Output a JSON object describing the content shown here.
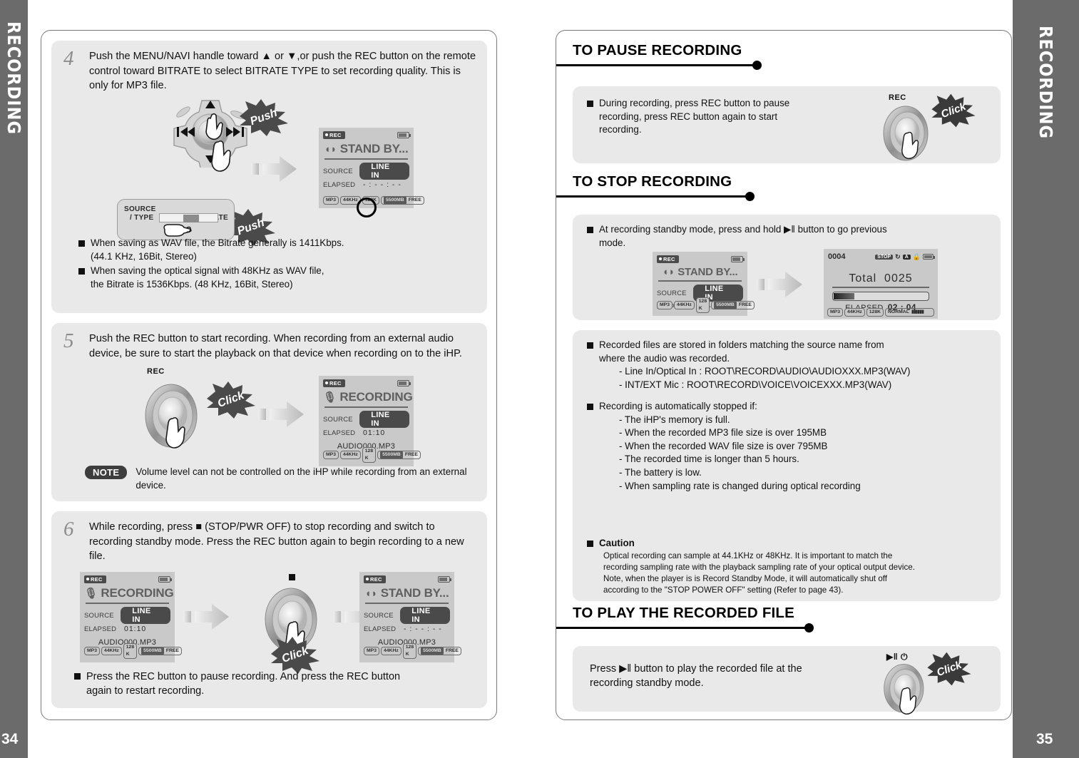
{
  "side_tabs": {
    "left_label": "RECORDING",
    "right_label": "RECORDING"
  },
  "page_numbers": {
    "left": "34",
    "right": "35"
  },
  "left_page": {
    "step4": {
      "number": "4",
      "text": "Push the MENU/NAVI handle toward ▲ or ▼,or push the REC button on the remote control toward BITRATE to select BITRATE TYPE to set recording quality. This is only for MP3 file.",
      "push_label_1": "Push",
      "push_label_2": "Push",
      "remote": {
        "left_label_line1": "SOURCE",
        "left_label_line2": "/ TYPE",
        "right_label": "BITRATE"
      },
      "lcd": {
        "rec": "REC",
        "title": "STAND BY...",
        "source_label": "SOURCE",
        "source_value": "LINE IN",
        "elapsed_label": "ELAPSED",
        "elapsed_value": "- : - - : - -",
        "tags": [
          "MP3",
          "44KHz",
          "128K"
        ],
        "used": "5500MB",
        "free": "FREE"
      },
      "bullets": [
        "When saving as WAV file, the Bitrate generally is 1411Kbps. (44.1 KHz, 16Bit, Stereo)",
        "When saving the optical signal with 48KHz as WAV file, the Bitrate is 1536Kbps. (48 KHz, 16Bit, Stereo)"
      ],
      "bullet_lines": [
        [
          "When saving as WAV file, the Bitrate generally is 1411Kbps.",
          "(44.1 KHz, 16Bit, Stereo)"
        ],
        [
          "When saving the optical signal with 48KHz as WAV file,",
          "the Bitrate is 1536Kbps. (48 KHz, 16Bit, Stereo)"
        ]
      ]
    },
    "step5": {
      "number": "5",
      "text": "Push the REC button to start recording. When recording from an external audio device, be sure to start the playback on that device when recording on to the iHP.",
      "rec_label": "REC",
      "click_label": "Click",
      "lcd": {
        "rec": "REC",
        "title": "RECORDING",
        "source_label": "SOURCE",
        "source_value": "LINE IN",
        "elapsed_label": "ELAPSED",
        "elapsed_value": "01:10",
        "file": "AUDIO000.MP3",
        "tags": [
          "MP3",
          "44KHz",
          "128 K"
        ],
        "used": "5500MB",
        "free": "FREE"
      },
      "note_badge": "NOTE",
      "note_text": "Volume level can not be controlled on the iHP while recording from an external device."
    },
    "step6": {
      "number": "6",
      "text": "While recording, press ■ (STOP/PWR OFF) to stop recording and switch to recording standby mode.  Press the REC button again to begin recording to a new file.",
      "click_label": "Click",
      "lcd_left": {
        "rec": "REC",
        "title": "RECORDING",
        "source_label": "SOURCE",
        "source_value": "LINE IN",
        "elapsed_label": "ELAPSED",
        "elapsed_value": "01:10",
        "file": "AUDIO000.MP3",
        "tags": [
          "MP3",
          "44KHz",
          "128 K"
        ],
        "used": "5500MB",
        "free": "FREE"
      },
      "lcd_right": {
        "rec": "REC",
        "title": "STAND BY...",
        "source_label": "SOURCE",
        "source_value": "LINE IN",
        "elapsed_label": "ELAPSED",
        "elapsed_value": "- : - - : - -",
        "file": "AUDIO000.MP3",
        "tags": [
          "MP3",
          "44KHz",
          "128 K"
        ],
        "used": "5500MB",
        "free": "FREE"
      },
      "bullet_lines": [
        "Press the REC button to pause recording. And press the REC button",
        "again to restart recording."
      ]
    }
  },
  "right_page": {
    "sections": [
      {
        "title": "TO PAUSE RECORDING"
      },
      {
        "title": "TO STOP RECORDING"
      },
      {
        "title": "TO PLAY THE RECORDED FILE"
      }
    ],
    "pause": {
      "bullet_lines": [
        "During recording, press REC button to pause",
        "recording, press REC button again to start",
        "recording."
      ],
      "rec_label": "REC",
      "click_label": "Click"
    },
    "stop": {
      "bullet_lines": [
        "At recording standby mode, press and hold  ▶‖  button to go previous",
        "mode."
      ],
      "lcd_left": {
        "rec": "REC",
        "title": "STAND BY...",
        "source_label": "SOURCE",
        "source_value": "LINE IN",
        "elapsed_label": "ELAPSED",
        "elapsed_value": "- : - - : - -",
        "tags": [
          "MP3",
          "44KHz",
          "128 K"
        ],
        "used": "5500MB",
        "free": "FREE"
      },
      "lcd_right": {
        "track": "0004",
        "status": "STOP",
        "mode_a": "A",
        "total_label": "Total",
        "total_value": "0025",
        "elapsed_label": "ELAPSED",
        "elapsed_value": "02 : 04",
        "tags": [
          "MP3",
          "44KHz",
          "128K"
        ],
        "eq": "NORMAL"
      }
    },
    "info": {
      "b1_lines": [
        "Recorded files are stored in folders matching the source name from",
        "where the audio was recorded."
      ],
      "b1_sub": [
        "- Line In/Optical In : ROOT\\RECORD\\AUDIO\\AUDIOXXX.MP3(WAV)",
        "- INT/EXT Mic :  ROOT\\RECORD\\VOICE\\VOICEXXX.MP3(WAV)"
      ],
      "b2_title": "Recording is automatically stopped if:",
      "b2_sub": [
        "- The iHP's memory is full.",
        "- When the recorded MP3 file size is over 195MB",
        "- When the recorded WAV file size is over 795MB",
        "- The recorded time is longer than 5 hours.",
        "- The battery is low.",
        "- When sampling rate is changed during optical recording"
      ],
      "caution_title": "Caution",
      "caution_lines": [
        "Optical recording can sample at 44.1KHz or 48KHz. It is important to match the",
        "recording sampling rate with the playback sampling rate of your optical output device.",
        "Note, when the player is is Record Standby Mode, it will automatically shut off",
        "according to the \"STOP POWER OFF\" setting (Refer to page 43)."
      ]
    },
    "play": {
      "lines": [
        "Press  ▶‖  button to play the recorded file at the",
        "recording standby mode."
      ],
      "btn_label": "▶‖ ⏻",
      "click_label": "Click"
    }
  }
}
